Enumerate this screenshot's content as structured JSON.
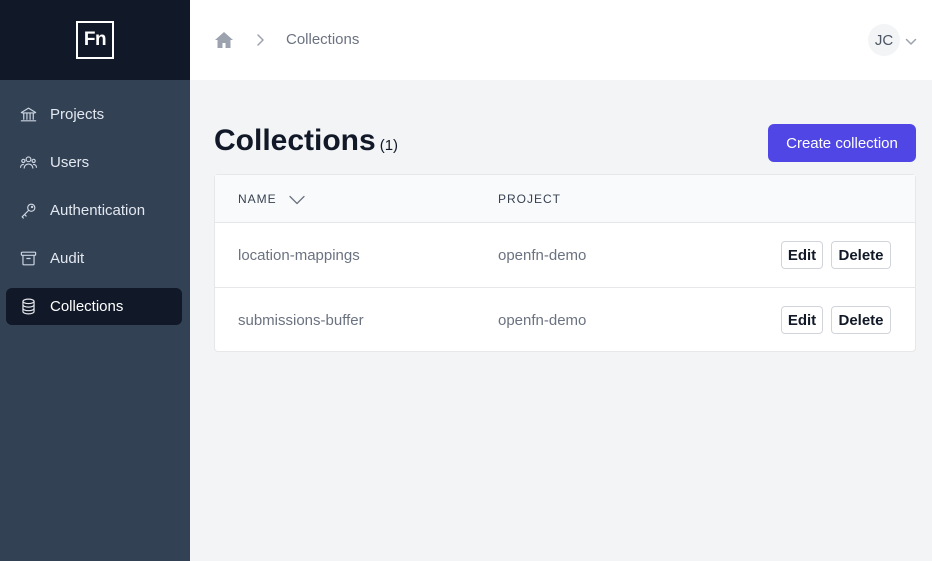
{
  "logo": {
    "text": "Fn"
  },
  "sidebar": {
    "items": [
      {
        "label": "Projects",
        "icon": "bank-icon",
        "active": false
      },
      {
        "label": "Users",
        "icon": "users-icon",
        "active": false
      },
      {
        "label": "Authentication",
        "icon": "key-icon",
        "active": false
      },
      {
        "label": "Audit",
        "icon": "archive-icon",
        "active": false
      },
      {
        "label": "Collections",
        "icon": "database-icon",
        "active": true
      }
    ]
  },
  "header": {
    "breadcrumb": {
      "home_icon": "home-icon",
      "current": "Collections"
    },
    "user": {
      "initials": "JC"
    }
  },
  "main": {
    "title": "Collections",
    "count": "(1)",
    "create_button": "Create collection",
    "table": {
      "columns": {
        "name": "NAME",
        "project": "PROJECT"
      },
      "rows": [
        {
          "name": "location-mappings",
          "project": "openfn-demo",
          "edit": "Edit",
          "delete": "Delete"
        },
        {
          "name": "submissions-buffer",
          "project": "openfn-demo",
          "edit": "Edit",
          "delete": "Delete"
        }
      ]
    }
  },
  "colors": {
    "sidebar_bg": "#334155",
    "sidebar_dark": "#111827",
    "accent": "#4f46e5",
    "page_bg": "#f3f4f6"
  }
}
